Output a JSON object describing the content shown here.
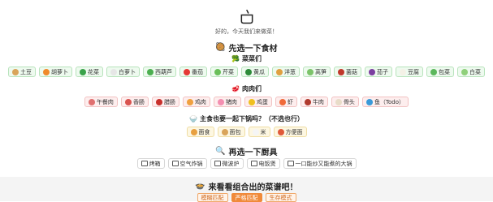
{
  "header": {
    "subtitle": "好的，今天我们来做菜！"
  },
  "ingredients": {
    "title": "先选一下食材",
    "veg_title": "菜菜们",
    "veg": [
      {
        "label": "土豆",
        "icon": "potato-icon",
        "color": "#d9a45a"
      },
      {
        "label": "胡萝卜",
        "icon": "carrot-icon",
        "color": "#f08a2a"
      },
      {
        "label": "花菜",
        "icon": "broccoli-icon",
        "color": "#3aa34a"
      },
      {
        "label": "白萝卜",
        "icon": "radish-icon",
        "color": "#e6e6e6"
      },
      {
        "label": "西葫芦",
        "icon": "zucchini-icon",
        "color": "#4caf50"
      },
      {
        "label": "番茄",
        "icon": "tomato-icon",
        "color": "#e53935"
      },
      {
        "label": "芹菜",
        "icon": "celery-icon",
        "color": "#6abf5a"
      },
      {
        "label": "黄瓜",
        "icon": "cucumber-icon",
        "color": "#2e8b3a"
      },
      {
        "label": "洋葱",
        "icon": "onion-icon",
        "color": "#e0a040"
      },
      {
        "label": "莴笋",
        "icon": "lettuce-icon",
        "color": "#7cc46a"
      },
      {
        "label": "菌菇",
        "icon": "mushroom-icon",
        "color": "#c0392b"
      },
      {
        "label": "茄子",
        "icon": "eggplant-icon",
        "color": "#7b3fa0"
      },
      {
        "label": "豆腐",
        "icon": "tofu-icon",
        "color": "#f4f1e6"
      },
      {
        "label": "包菜",
        "icon": "cabbage-icon",
        "color": "#5cb85c"
      },
      {
        "label": "白菜",
        "icon": "bokchoy-icon",
        "color": "#8fd07a"
      }
    ],
    "meat_title": "肉肉们",
    "meat": [
      {
        "label": "午餐肉",
        "icon": "luncheon-meat-icon",
        "color": "#e07070"
      },
      {
        "label": "香肠",
        "icon": "sausage-icon",
        "color": "#d9534f"
      },
      {
        "label": "腊肠",
        "icon": "cured-sausage-icon",
        "color": "#c9302c"
      },
      {
        "label": "鸡肉",
        "icon": "chicken-icon",
        "color": "#f0a040"
      },
      {
        "label": "猪肉",
        "icon": "pork-icon",
        "color": "#f48fb1"
      },
      {
        "label": "鸡蛋",
        "icon": "egg-icon",
        "color": "#f0c020"
      },
      {
        "label": "虾",
        "icon": "shrimp-icon",
        "color": "#f06a3a"
      },
      {
        "label": "牛肉",
        "icon": "beef-icon",
        "color": "#b03a2e"
      },
      {
        "label": "骨头",
        "icon": "bone-icon",
        "color": "#e8dcc8"
      },
      {
        "label": "鱼（Todo）",
        "icon": "fish-icon",
        "color": "#3a9ad9"
      }
    ],
    "staple_title": "主食也要一起下锅吗？（不选也行）",
    "staple": [
      {
        "label": "面食",
        "icon": "noodles-icon",
        "color": "#e8a040"
      },
      {
        "label": "面包",
        "icon": "bread-icon",
        "color": "#d9a45a"
      },
      {
        "label": "米",
        "icon": "rice-icon",
        "color": "#f5f5f5"
      },
      {
        "label": "方便面",
        "icon": "instant-noodles-icon",
        "color": "#e05a3a"
      }
    ]
  },
  "tools": {
    "title": "再选一下厨具",
    "items": [
      {
        "label": "烤箱",
        "icon": "oven-icon"
      },
      {
        "label": "空气炸锅",
        "icon": "air-fryer-icon"
      },
      {
        "label": "微波炉",
        "icon": "microwave-icon"
      },
      {
        "label": "电饭煲",
        "icon": "rice-cooker-icon"
      },
      {
        "label": "一口能炒又能煮的大锅",
        "icon": "wok-icon"
      }
    ]
  },
  "result": {
    "title": "来看看组合出的菜谱吧！",
    "modes": [
      {
        "label": "模糊匹配",
        "active": false
      },
      {
        "label": "严格匹配",
        "active": true
      },
      {
        "label": "生存模式",
        "active": false
      }
    ]
  }
}
